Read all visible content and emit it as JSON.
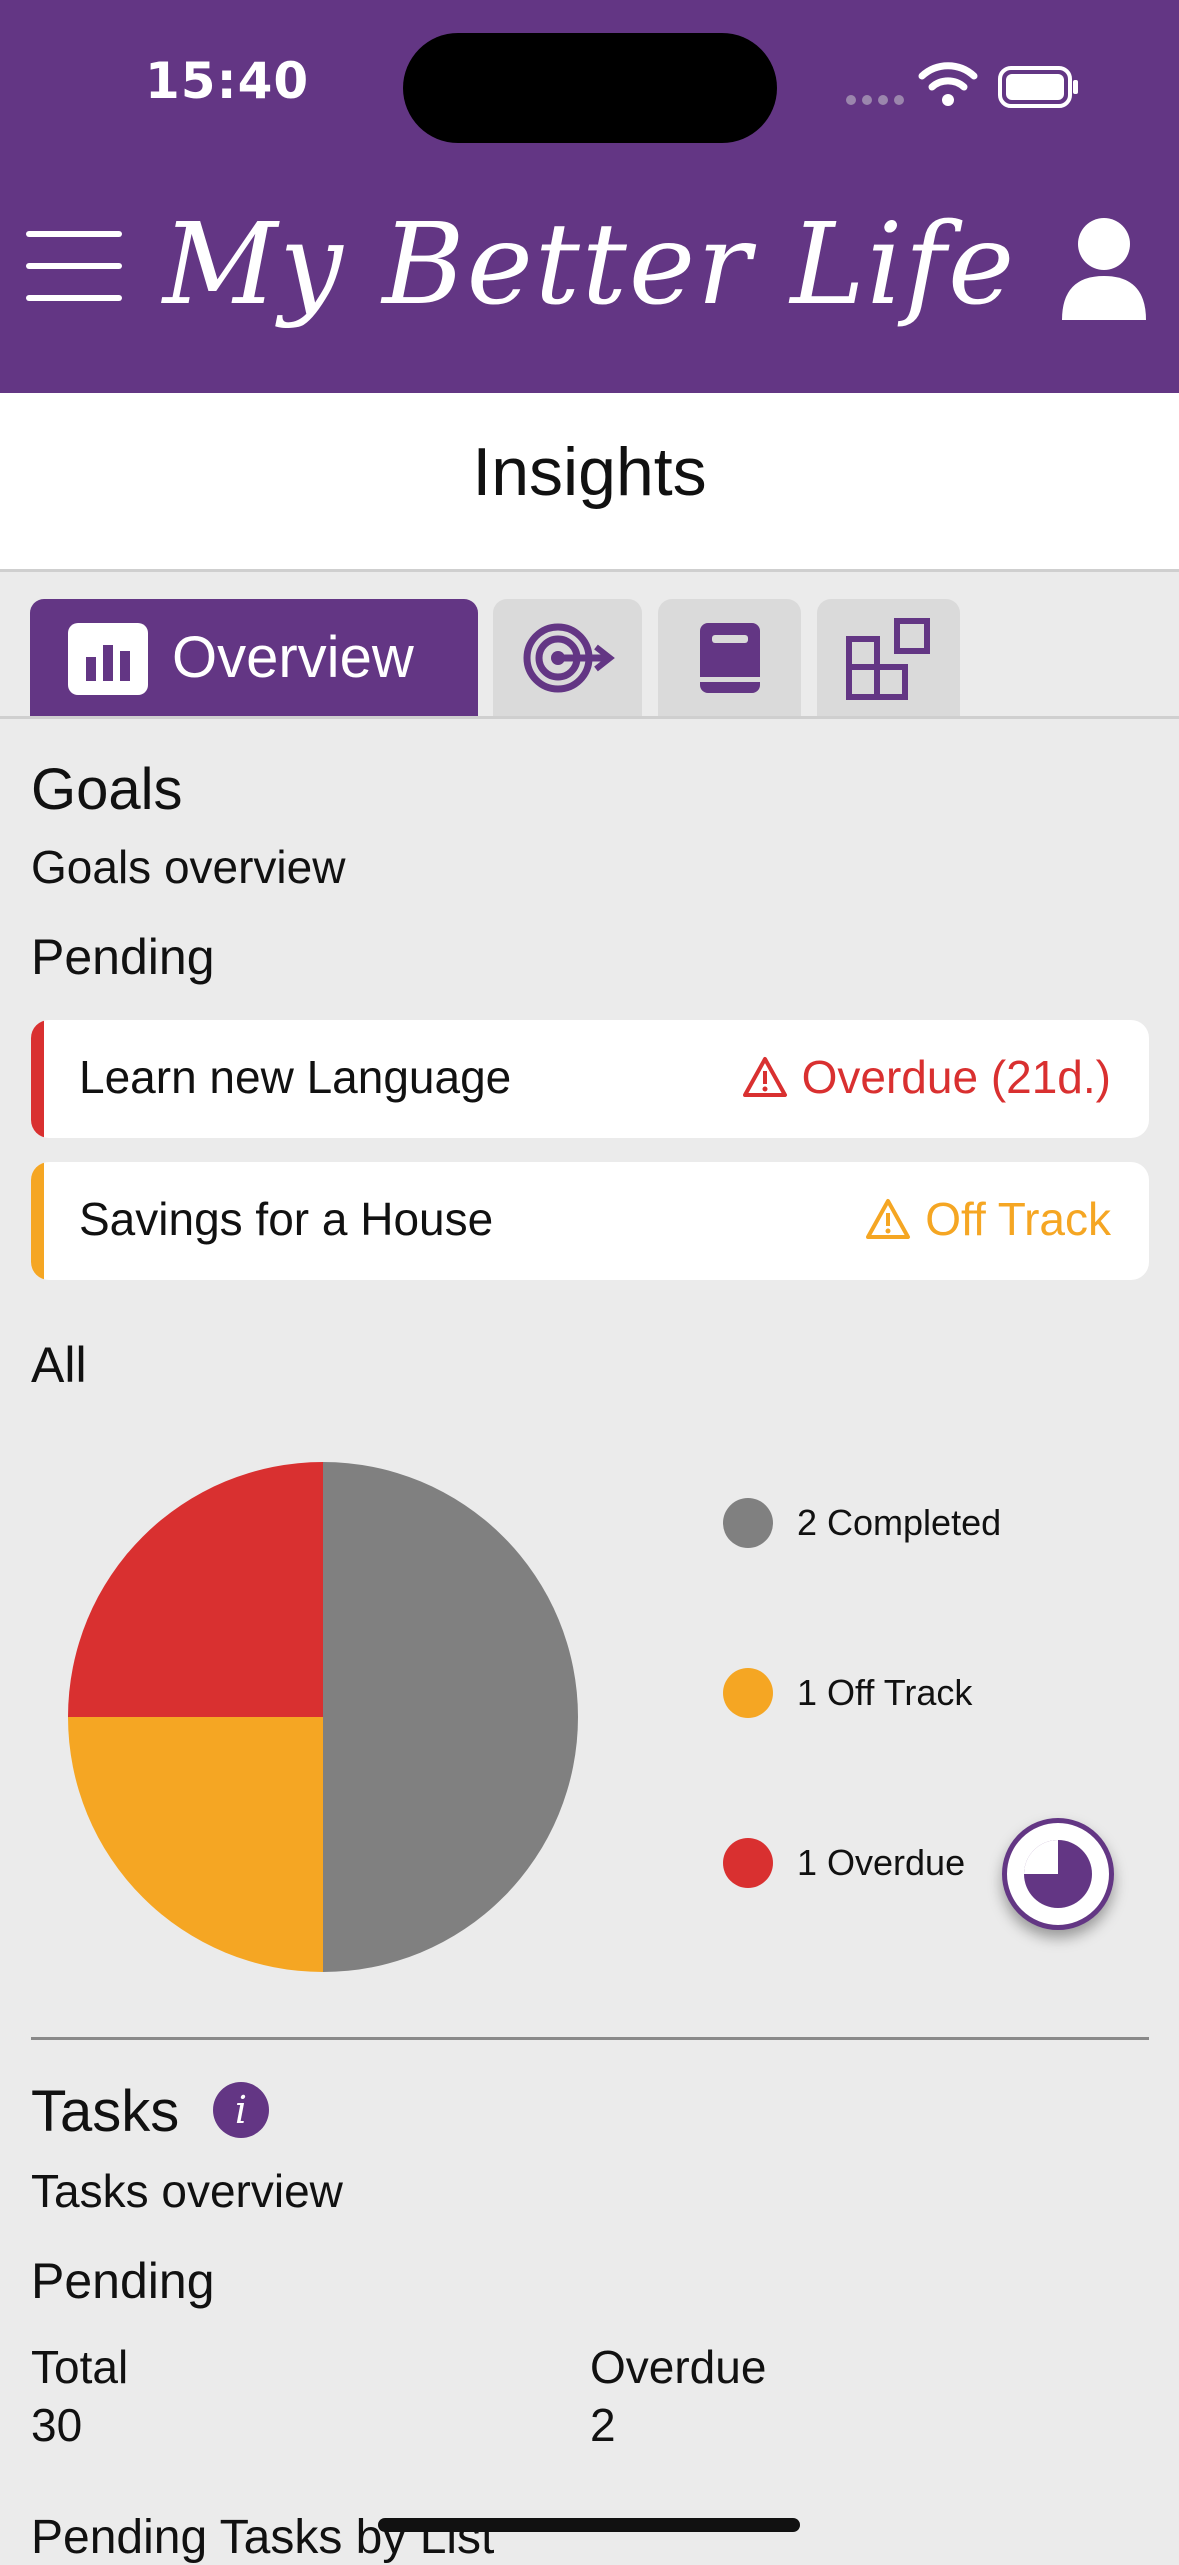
{
  "status_bar": {
    "time": "15:40"
  },
  "header": {
    "app_title": "My Better Life"
  },
  "page": {
    "title": "Insights"
  },
  "tabs": [
    {
      "label": "Overview",
      "icon": "bar-chart-icon",
      "active": true
    },
    {
      "label": "",
      "icon": "target-icon",
      "active": false
    },
    {
      "label": "",
      "icon": "book-icon",
      "active": false
    },
    {
      "label": "",
      "icon": "widgets-icon",
      "active": false
    }
  ],
  "goals": {
    "heading": "Goals",
    "subtitle": "Goals overview",
    "pending_heading": "Pending",
    "pending": [
      {
        "name": "Learn new Language",
        "status": "Overdue (21d.)",
        "color": "#d93030"
      },
      {
        "name": "Savings for a House",
        "status": "Off Track",
        "color": "#f5a623"
      }
    ],
    "all_heading": "All"
  },
  "chart_data": {
    "type": "pie",
    "slices": [
      {
        "label": "2 Completed",
        "value": 2,
        "color": "#808080"
      },
      {
        "label": "1 Off Track",
        "value": 1,
        "color": "#f5a623"
      },
      {
        "label": "1 Overdue",
        "value": 1,
        "color": "#d93030"
      }
    ],
    "legend_placement": "right"
  },
  "tasks": {
    "heading": "Tasks",
    "subtitle": "Tasks overview",
    "pending_heading": "Pending",
    "total_label": "Total",
    "total_value": "30",
    "overdue_label": "Overdue",
    "overdue_value": "2",
    "by_list_heading": "Pending Tasks by List"
  },
  "colors": {
    "brand": "#633684",
    "overdue": "#d93030",
    "off_track": "#f5a623",
    "completed": "#808080"
  }
}
